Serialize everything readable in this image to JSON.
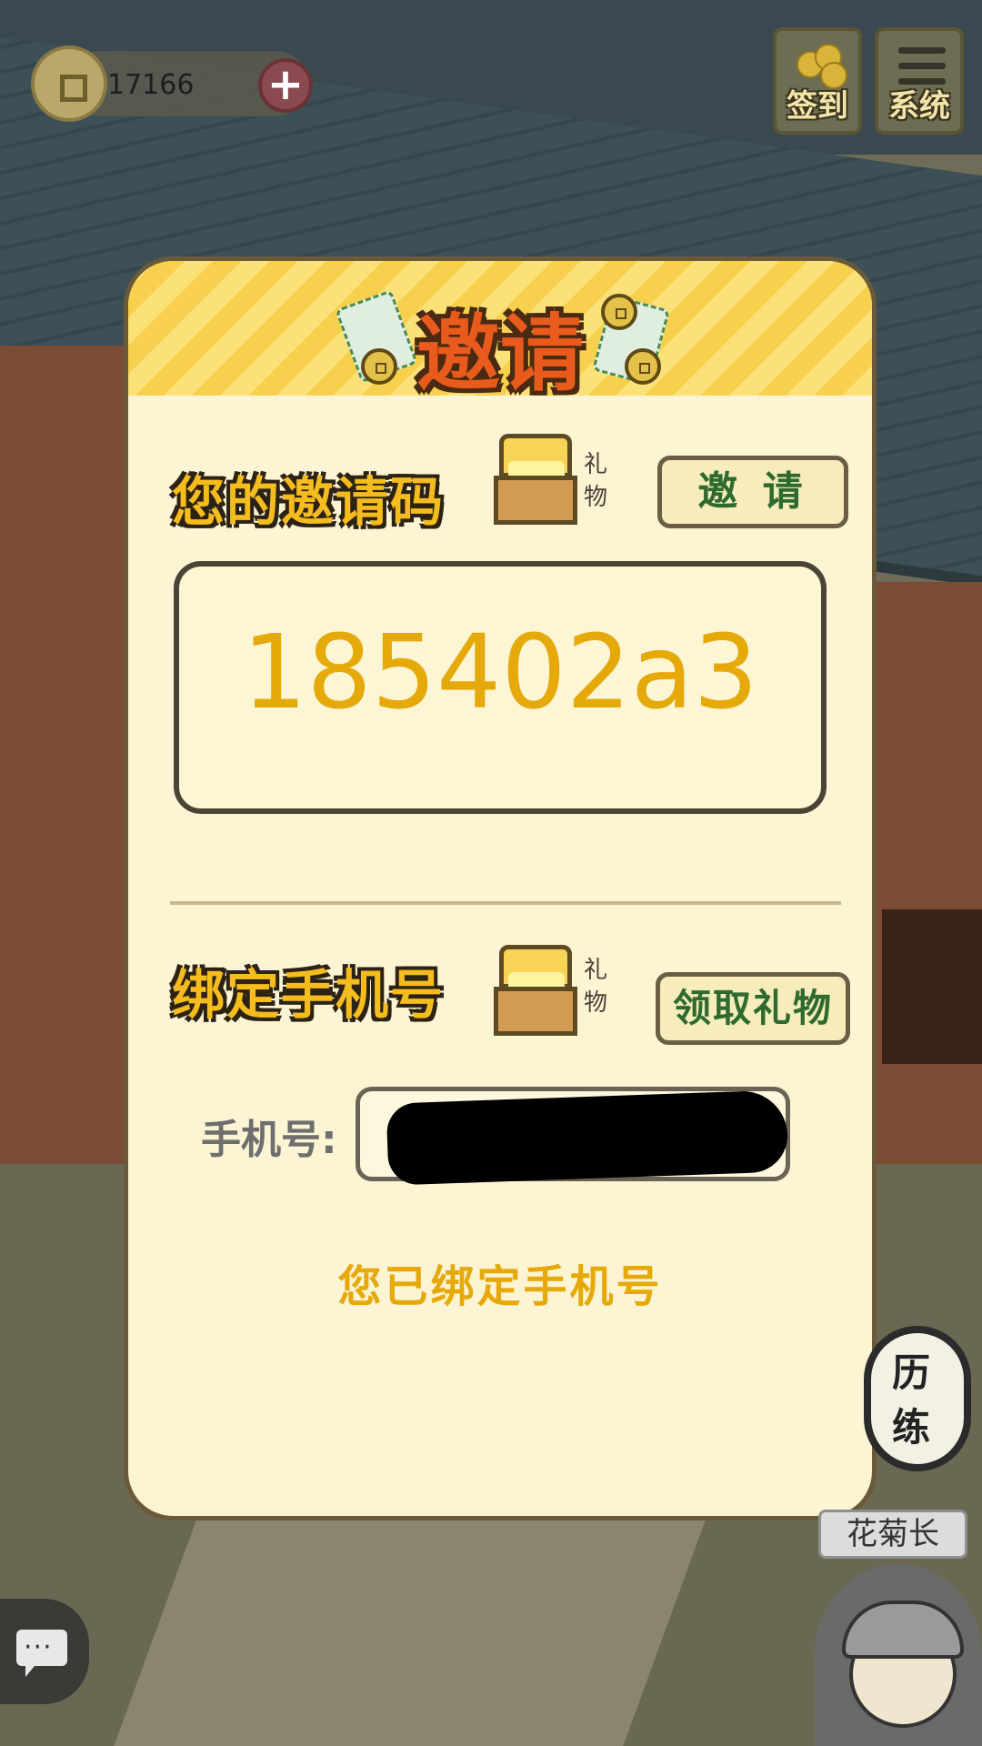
{
  "hud": {
    "coin_amount": "17166",
    "plus_icon": "+",
    "signin_label": "签到",
    "system_label": "系统"
  },
  "modal": {
    "title": "邀请",
    "invite_section": {
      "title": "您的邀请码",
      "gift_label": "礼物",
      "invite_button": "邀 请",
      "invite_code": "185402a3"
    },
    "bind_section": {
      "title": "绑定手机号",
      "gift_label": "礼物",
      "claim_button": "领取礼物",
      "phone_label": "手机号:",
      "phone_value": "",
      "status_message": "您已绑定手机号"
    }
  },
  "side": {
    "experience_label": "历练",
    "character_name": "花菊长"
  },
  "icons": {
    "coin": "coin-icon",
    "plus": "plus-icon",
    "signin": "coins-icon",
    "system": "menu-icon",
    "chest": "treasure-chest-icon",
    "chat": "chat-icon"
  },
  "colors": {
    "title_orange": "#e95a1d",
    "gold_text": "#e5a90a",
    "section_gold": "#f5bc1e",
    "button_green": "#2f6a2f",
    "panel_bg": "#fdf4d4"
  }
}
